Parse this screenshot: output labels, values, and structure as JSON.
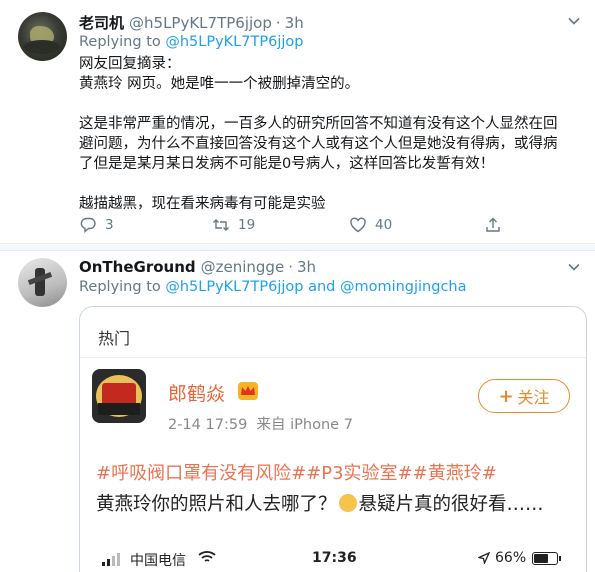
{
  "tweet1": {
    "name": "老司机",
    "handle": "@h5LPyKL7TP6jjop",
    "time": "3h",
    "replying_prefix": "Replying to",
    "replying_to": "@h5LPyKL7TP6jjop",
    "body_lines": [
      "网友回复摘录：",
      "黄燕玲 网页。她是唯一一个被删掉清空的。",
      "",
      "这是非常严重的情况，一百多人的研究所回答不知道有没有这个人显然在回",
      "避问题，为什么不直接回答没有这个人或有这个人但是她没有得病，或得病",
      "了但是是某月某日发病不可能是0号病人，这样回答比发誓有效！",
      "",
      "越描越黑，现在看来病毒有可能是实验"
    ],
    "reply_count": "3",
    "retweet_count": "19",
    "like_count": "40"
  },
  "tweet2": {
    "name": "OnTheGround",
    "handle": "@zeningge",
    "time": "3h",
    "replying_prefix": "Replying to",
    "replying_to_1": "@h5LPyKL7TP6jjop",
    "replying_and": "and",
    "replying_to_2": "@momingjingcha",
    "embed": {
      "section_title": "热门",
      "account_name": "郎鹤焱",
      "post_time": "2-14 17:59",
      "post_source": "来自 iPhone 7",
      "follow_label": "关注",
      "tags": "#呼吸阀口罩有没有风险##P3实验室##黄燕玲#",
      "text_part1": "黄燕玲你的照片和人去哪了？",
      "text_part2": "悬疑片真的很好看……",
      "phone_status": {
        "carrier": "中国电信",
        "clock": "17:36",
        "battery_pct": "66%",
        "battery_level": 0.66
      }
    }
  },
  "colors": {
    "link": "#1da1f2",
    "muted": "#657786",
    "weibo_orange": "#e58a2e",
    "weibo_tag": "#eb7350"
  }
}
